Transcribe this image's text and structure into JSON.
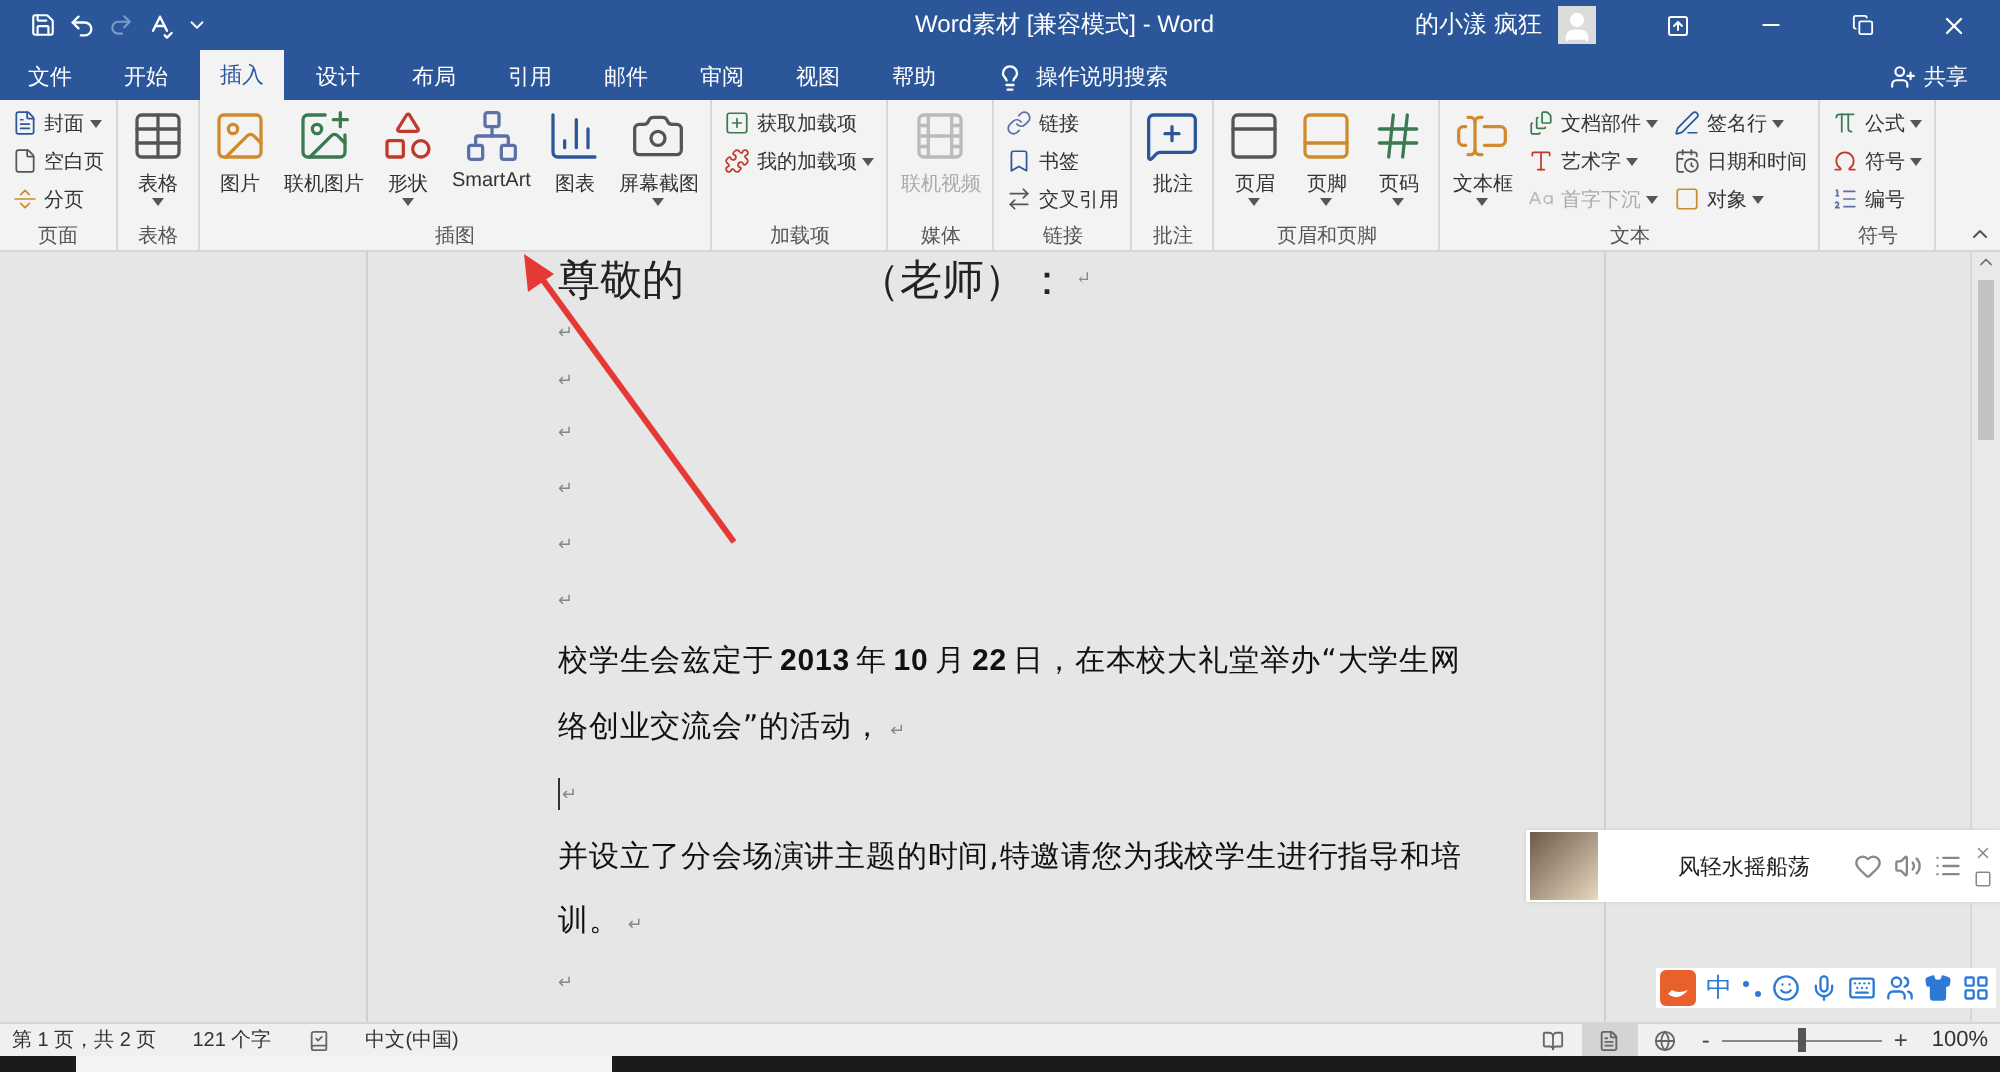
{
  "window": {
    "title": "Word素材 [兼容模式] - Word",
    "user": "的小漾 疯狂"
  },
  "tabs": [
    {
      "label": "文件",
      "selected": false
    },
    {
      "label": "开始",
      "selected": false
    },
    {
      "label": "插入",
      "selected": true
    },
    {
      "label": "设计",
      "selected": false
    },
    {
      "label": "布局",
      "selected": false
    },
    {
      "label": "引用",
      "selected": false
    },
    {
      "label": "邮件",
      "selected": false
    },
    {
      "label": "审阅",
      "selected": false
    },
    {
      "label": "视图",
      "selected": false
    },
    {
      "label": "帮助",
      "selected": false
    }
  ],
  "tell_me": "操作说明搜索",
  "share": "共享",
  "ribbon": {
    "groups": [
      {
        "label": "页面",
        "items": [
          {
            "kind": "small",
            "label": "封面",
            "dropdown": true,
            "disabled": false
          },
          {
            "kind": "small",
            "label": "空白页",
            "dropdown": false,
            "disabled": false
          },
          {
            "kind": "small",
            "label": "分页",
            "dropdown": false,
            "disabled": false
          }
        ]
      },
      {
        "label": "表格",
        "items": [
          {
            "kind": "large",
            "label": "表格",
            "dropdown": true,
            "disabled": false
          }
        ]
      },
      {
        "label": "插图",
        "items": [
          {
            "kind": "large",
            "label": "图片",
            "dropdown": false,
            "disabled": false
          },
          {
            "kind": "large",
            "label": "联机图片",
            "dropdown": false,
            "disabled": false
          },
          {
            "kind": "large",
            "label": "形状",
            "dropdown": true,
            "disabled": false
          },
          {
            "kind": "large",
            "label": "SmartArt",
            "dropdown": false,
            "disabled": false
          },
          {
            "kind": "large",
            "label": "图表",
            "dropdown": false,
            "disabled": false
          },
          {
            "kind": "large",
            "label": "屏幕截图",
            "dropdown": true,
            "disabled": false
          }
        ]
      },
      {
        "label": "加载项",
        "items": [
          {
            "kind": "small",
            "label": "获取加载项",
            "dropdown": false,
            "disabled": false
          },
          {
            "kind": "small",
            "label": "我的加载项",
            "dropdown": true,
            "disabled": false
          }
        ]
      },
      {
        "label": "媒体",
        "items": [
          {
            "kind": "large",
            "label": "联机视频",
            "dropdown": false,
            "disabled": true
          }
        ]
      },
      {
        "label": "链接",
        "items": [
          {
            "kind": "small",
            "label": "链接",
            "dropdown": false,
            "disabled": false
          },
          {
            "kind": "small",
            "label": "书签",
            "dropdown": false,
            "disabled": false
          },
          {
            "kind": "small",
            "label": "交叉引用",
            "dropdown": false,
            "disabled": false
          }
        ]
      },
      {
        "label": "批注",
        "items": [
          {
            "kind": "large",
            "label": "批注",
            "dropdown": false,
            "disabled": false
          }
        ]
      },
      {
        "label": "页眉和页脚",
        "items": [
          {
            "kind": "large",
            "label": "页眉",
            "dropdown": true,
            "disabled": false
          },
          {
            "kind": "large",
            "label": "页脚",
            "dropdown": true,
            "disabled": false
          },
          {
            "kind": "large",
            "label": "页码",
            "dropdown": true,
            "disabled": false
          }
        ]
      },
      {
        "label": "文本",
        "items": [
          {
            "kind": "large",
            "label": "文本框",
            "dropdown": true,
            "disabled": false
          },
          {
            "kind": "small",
            "label": "文档部件",
            "dropdown": true,
            "disabled": false
          },
          {
            "kind": "small",
            "label": "艺术字",
            "dropdown": true,
            "disabled": false
          },
          {
            "kind": "small",
            "label": "首字下沉",
            "dropdown": true,
            "disabled": true
          },
          {
            "kind": "small",
            "label": "签名行",
            "dropdown": true,
            "disabled": false
          },
          {
            "kind": "small",
            "label": "日期和时间",
            "dropdown": false,
            "disabled": false
          },
          {
            "kind": "small",
            "label": "对象",
            "dropdown": true,
            "disabled": false
          }
        ]
      },
      {
        "label": "符号",
        "items": [
          {
            "kind": "small",
            "label": "公式",
            "dropdown": true,
            "disabled": false
          },
          {
            "kind": "small",
            "label": "符号",
            "dropdown": true,
            "disabled": false
          },
          {
            "kind": "small",
            "label": "编号",
            "dropdown": false,
            "disabled": false
          }
        ]
      }
    ]
  },
  "document": {
    "heading": {
      "left": "尊敬的",
      "right": "（老师）：",
      "mark": "↵"
    },
    "paragraphs": [
      {
        "kind": "empty",
        "mark": "↵",
        "cursor": false
      },
      {
        "kind": "empty",
        "mark": "↵",
        "cursor": false
      },
      {
        "kind": "empty",
        "mark": "↵",
        "cursor": false
      },
      {
        "kind": "empty",
        "mark": "↵",
        "cursor": false
      },
      {
        "kind": "empty",
        "mark": "↵",
        "cursor": false
      },
      {
        "kind": "empty",
        "mark": "↵",
        "cursor": false
      },
      {
        "kind": "text",
        "text": "校学生会兹定于 **2013** 年 **10** 月 **22** 日，在本校大礼堂举办“大学生网络创业交流会”的活动，",
        "mark": "↵"
      },
      {
        "kind": "empty",
        "mark": "↵",
        "cursor": true
      },
      {
        "kind": "text",
        "text": "并设立了分会场演讲主题的时间,特邀请您为我校学生进行指导和培训。",
        "mark": "↵"
      },
      {
        "kind": "empty",
        "mark": "↵",
        "cursor": false
      }
    ]
  },
  "music_player": {
    "title": "风轻水摇船荡"
  },
  "ime_bar": {
    "mode": "中"
  },
  "status_bar": {
    "page": "第 1 页，共 2 页",
    "words": "121 个字",
    "language": "中文(中国)",
    "zoom_out": "-",
    "zoom_in": "+",
    "zoom_label": "100%",
    "zoom": {
      "level": 0.5
    }
  }
}
